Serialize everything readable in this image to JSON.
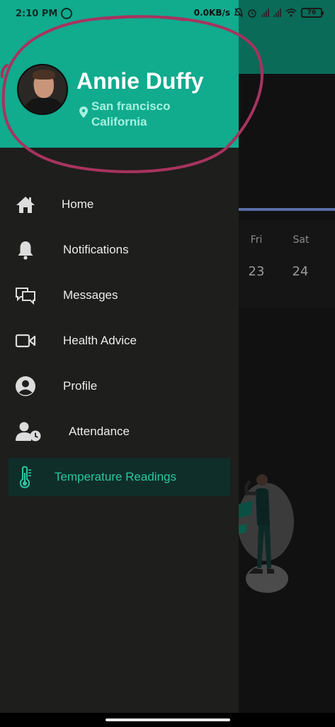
{
  "status_bar": {
    "time": "2:10 PM",
    "net_speed": "0.0KB/s",
    "battery": "76"
  },
  "user": {
    "name": "Annie Duffy",
    "location_line1": "San francisco",
    "location_line2": "California"
  },
  "menu": [
    {
      "label": "Home",
      "icon": "home-icon"
    },
    {
      "label": "Notifications",
      "icon": "bell-icon"
    },
    {
      "label": "Messages",
      "icon": "messages-icon"
    },
    {
      "label": "Health Advice",
      "icon": "video-icon"
    },
    {
      "label": "Profile",
      "icon": "account-circle-icon"
    },
    {
      "label": "Attendance",
      "icon": "user-clock-icon"
    },
    {
      "label": "Temperature Readings",
      "icon": "thermometer-icon",
      "active": true
    }
  ],
  "background": {
    "day_names": [
      "Fri",
      "Sat"
    ],
    "day_numbers": [
      "23",
      "24"
    ]
  },
  "colors": {
    "header": "#11ab8e",
    "drawer": "#1e1e1c",
    "active_text": "#2bc7a0",
    "annotation": "#a7335e"
  }
}
